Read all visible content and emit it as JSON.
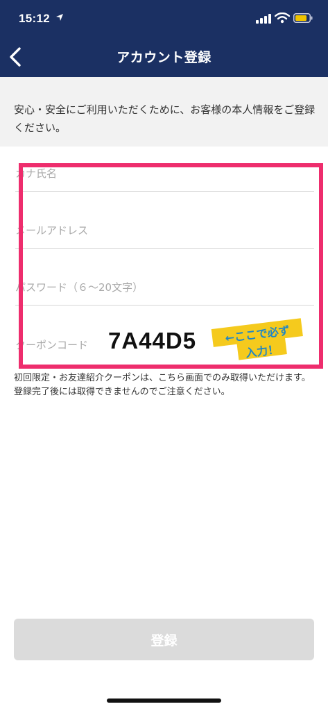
{
  "status_bar": {
    "time": "15:12",
    "icons": [
      "location-arrow-icon",
      "signal-bars-icon",
      "wifi-icon",
      "battery-icon"
    ],
    "battery_color": "#f0c400"
  },
  "header": {
    "title": "アカウント登録",
    "background_color": "#1b3063",
    "back_icon": "chevron-left-icon"
  },
  "intro": {
    "text": "安心・安全にご利用いただくために、お客様の本人情報をご登録ください。"
  },
  "form": {
    "fields": [
      {
        "placeholder": "カナ氏名",
        "value": ""
      },
      {
        "placeholder": "メールアドレス",
        "value": ""
      },
      {
        "placeholder": "パスワード（６〜20文字）",
        "value": ""
      },
      {
        "placeholder": "クーポンコード",
        "value": ""
      }
    ],
    "coupon_note": "初回限定・お友達紹介クーポンは、こちら画面でのみ取得いただけます。登録完了後には取得できませんのでご注意ください。"
  },
  "annotation": {
    "coupon_code": "7A44D5",
    "note_line1": "←ここで必ず",
    "note_line2": "入力！",
    "highlight_color": "#ee2d6d",
    "note_color": "#1f86c6",
    "tape_color": "#f5ca1d"
  },
  "footer": {
    "register_label": "登録",
    "button_color": "#dbdbdb"
  }
}
